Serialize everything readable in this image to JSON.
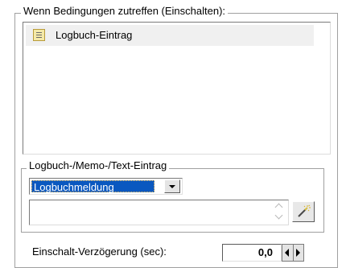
{
  "conditions_group": {
    "label": "Wenn Bedingungen zutreffen (Einschalten):",
    "items": [
      {
        "icon": "logbook-entry-icon",
        "label": "Logbuch-Eintrag"
      }
    ]
  },
  "entry_group": {
    "label": "Logbuch-/Memo-/Text-Eintrag",
    "type_select": {
      "value": "Logbuchmeldung"
    },
    "text": {
      "value": ""
    },
    "wand_button_icon": "magic-wand-icon"
  },
  "delay": {
    "label": "Einschalt-Verzögerung (sec):",
    "value": "0,0"
  },
  "colors": {
    "selection": "#0a58c0",
    "item_highlight": "#f0f0f0",
    "group_border": "#a0a0a0"
  }
}
